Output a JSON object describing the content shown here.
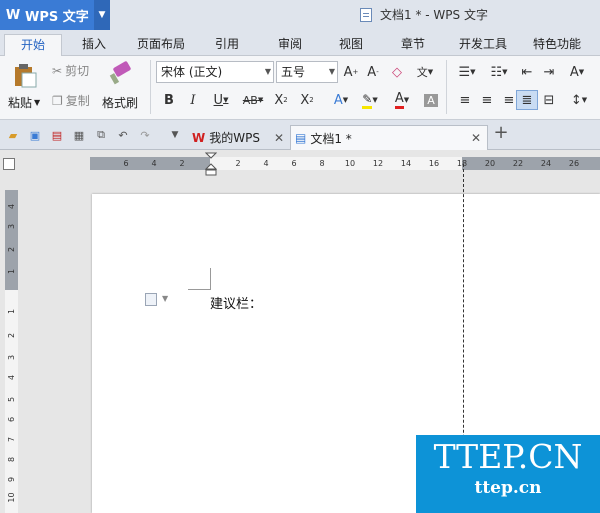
{
  "app": {
    "name": "WPS 文字",
    "logo_letter": "W",
    "window_title": "文档1 * - WPS 文字"
  },
  "menu_tabs": [
    "开始",
    "插入",
    "页面布局",
    "引用",
    "审阅",
    "视图",
    "章节",
    "开发工具",
    "特色功能"
  ],
  "clipboard": {
    "paste": "粘贴",
    "cut": "剪切",
    "copy": "复制",
    "format_painter": "格式刷"
  },
  "font": {
    "family": "宋体 (正文)",
    "size": "五号"
  },
  "doc_tabs": {
    "home": "我的WPS",
    "current": "文档1 *"
  },
  "ruler": {
    "h_numbers": [
      "6",
      "4",
      "2",
      "2",
      "4",
      "6",
      "8",
      "10",
      "12",
      "14",
      "16",
      "18",
      "20",
      "22",
      "24",
      "26"
    ],
    "v_numbers": [
      "4",
      "3",
      "2",
      "1",
      "1",
      "2",
      "3",
      "4",
      "5",
      "6",
      "7",
      "8",
      "9",
      "10"
    ]
  },
  "document": {
    "text": "建议栏："
  },
  "watermark": {
    "line1": "TTEP.CN",
    "line2": "ttep.cn"
  },
  "colors": {
    "accent": "#3a7bd5",
    "highlight": "#f7e600",
    "font_color": "#e02020",
    "watermark_bg": "#0d93d7"
  }
}
